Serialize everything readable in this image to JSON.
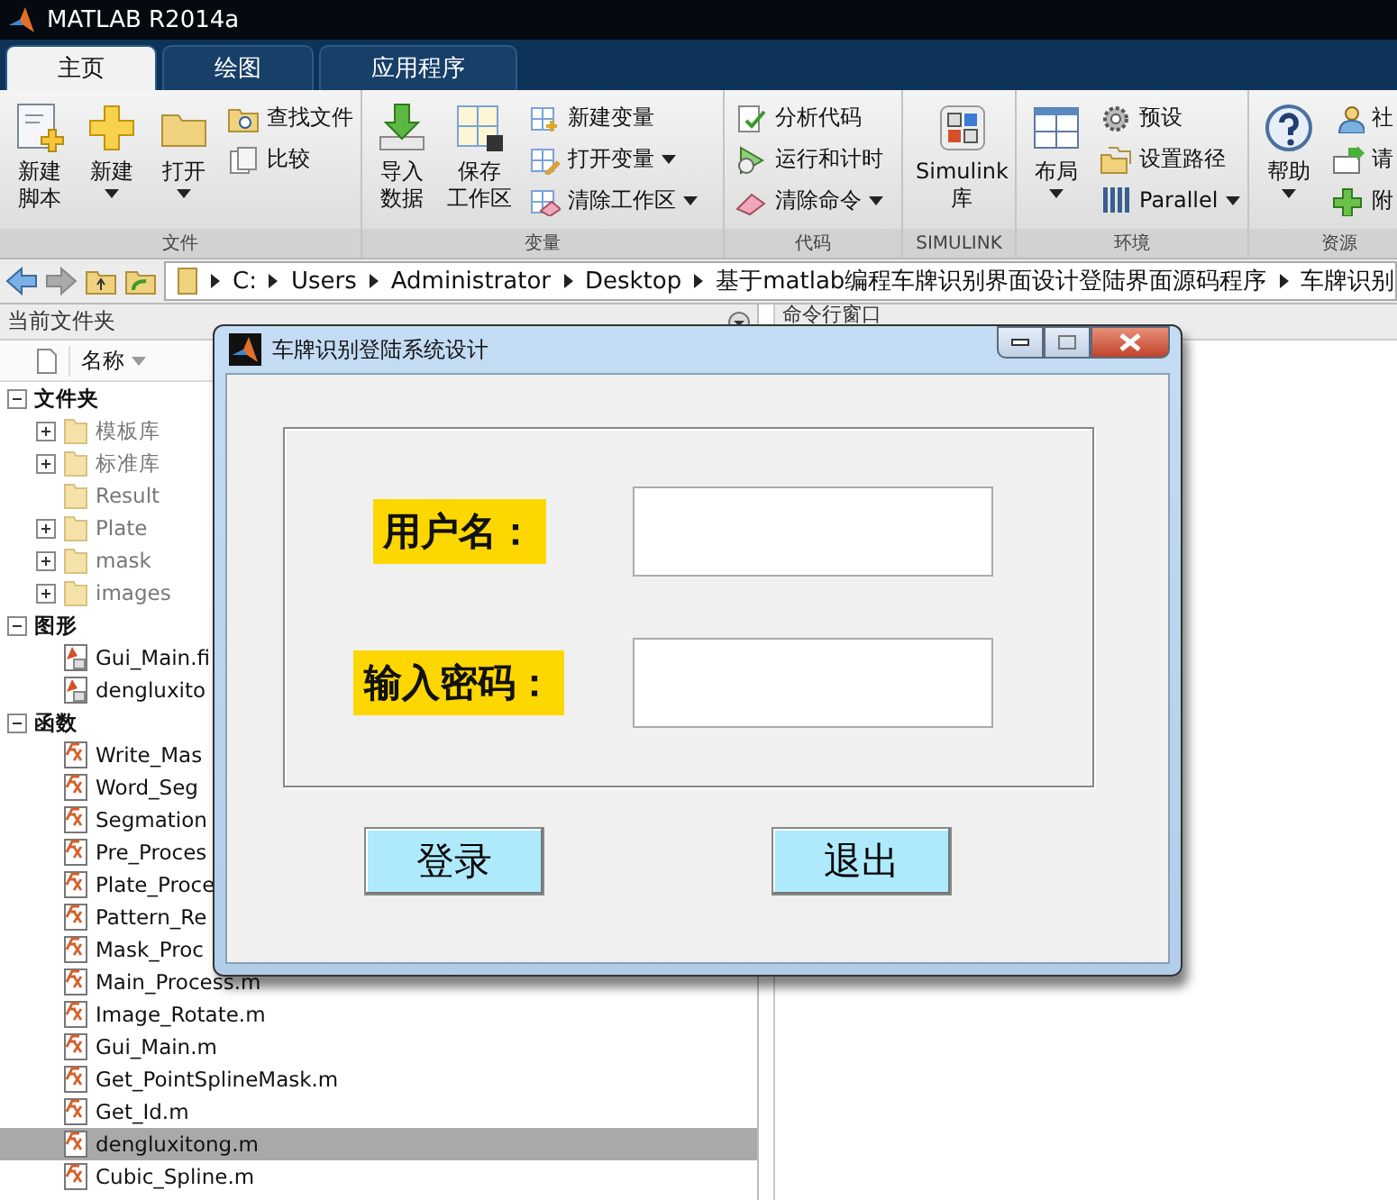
{
  "window": {
    "title": "MATLAB R2014a"
  },
  "tabs": [
    {
      "label": "主页",
      "selected": true
    },
    {
      "label": "绘图",
      "selected": false
    },
    {
      "label": "应用程序",
      "selected": false
    }
  ],
  "ribbon": {
    "groups": [
      {
        "label": "文件",
        "items": [
          {
            "kind": "large",
            "lines": [
              "新建",
              "脚本"
            ],
            "dropdown": false
          },
          {
            "kind": "large",
            "lines": [
              "新建"
            ],
            "dropdown": true
          },
          {
            "kind": "large",
            "lines": [
              "打开"
            ],
            "dropdown": true
          },
          {
            "kind": "stack",
            "items": [
              {
                "label": "查找文件",
                "dropdown": false
              },
              {
                "label": "比较",
                "dropdown": false
              }
            ]
          }
        ]
      },
      {
        "label": "变量",
        "items": [
          {
            "kind": "large",
            "lines": [
              "导入",
              "数据"
            ],
            "dropdown": false
          },
          {
            "kind": "large",
            "lines": [
              "保存",
              "工作区"
            ],
            "dropdown": false
          },
          {
            "kind": "stack",
            "items": [
              {
                "label": "新建变量",
                "dropdown": false
              },
              {
                "label": "打开变量",
                "dropdown": true
              },
              {
                "label": "清除工作区",
                "dropdown": true
              }
            ]
          }
        ]
      },
      {
        "label": "代码",
        "items": [
          {
            "kind": "stack",
            "items": [
              {
                "label": "分析代码",
                "dropdown": false
              },
              {
                "label": "运行和计时",
                "dropdown": false
              },
              {
                "label": "清除命令",
                "dropdown": true
              }
            ]
          }
        ]
      },
      {
        "label": "SIMULINK",
        "items": [
          {
            "kind": "large",
            "lines": [
              "Simulink",
              "库"
            ],
            "dropdown": false
          }
        ]
      },
      {
        "label": "环境",
        "items": [
          {
            "kind": "large",
            "lines": [
              "布局"
            ],
            "dropdown": true
          },
          {
            "kind": "stack",
            "items": [
              {
                "label": "预设",
                "dropdown": false
              },
              {
                "label": "设置路径",
                "dropdown": false
              },
              {
                "label": "Parallel",
                "dropdown": true
              }
            ]
          }
        ]
      },
      {
        "label": "资源",
        "items": [
          {
            "kind": "large",
            "lines": [
              "帮助"
            ],
            "dropdown": true
          },
          {
            "kind": "stack",
            "items": [
              {
                "label": "社"
              },
              {
                "label": "请"
              },
              {
                "label": "附"
              }
            ]
          }
        ]
      }
    ]
  },
  "address_bar": {
    "path": [
      "C:",
      "Users",
      "Administrator",
      "Desktop",
      "基于matlab编程车牌识别界面设计登陆界面源码程序",
      "车牌识别"
    ]
  },
  "current_folder": {
    "title": "当前文件夹",
    "column": "名称",
    "tree": [
      {
        "kind": "section",
        "label": "文件夹",
        "expanded": true,
        "selected": false,
        "children": [
          {
            "kind": "folder",
            "label": "模板库",
            "expanded": false,
            "selected": false
          },
          {
            "kind": "folder",
            "label": "标准库",
            "expanded": false,
            "selected": false
          },
          {
            "kind": "folder",
            "label": "Result",
            "selected": false
          },
          {
            "kind": "folder",
            "label": "Plate",
            "expanded": false,
            "selected": false
          },
          {
            "kind": "folder",
            "label": "mask",
            "expanded": false,
            "selected": false
          },
          {
            "kind": "folder",
            "label": "images",
            "expanded": false,
            "selected": false
          }
        ]
      },
      {
        "kind": "section",
        "label": "图形",
        "expanded": true,
        "selected": false,
        "children": [
          {
            "kind": "figure",
            "label": "Gui_Main.fi",
            "selected": false
          },
          {
            "kind": "figure",
            "label": "dengluxito",
            "selected": false
          }
        ]
      },
      {
        "kind": "section",
        "label": "函数",
        "expanded": true,
        "selected": false,
        "children": [
          {
            "kind": "function",
            "label": "Write_Mas",
            "selected": false
          },
          {
            "kind": "function",
            "label": "Word_Seg",
            "selected": false
          },
          {
            "kind": "function",
            "label": "Segmation",
            "selected": false
          },
          {
            "kind": "function",
            "label": "Pre_Proces",
            "selected": false
          },
          {
            "kind": "function",
            "label": "Plate_Proce",
            "selected": false
          },
          {
            "kind": "function",
            "label": "Pattern_Re",
            "selected": false
          },
          {
            "kind": "function",
            "label": "Mask_Proc",
            "selected": false
          },
          {
            "kind": "function",
            "label": "Main_Process.m",
            "selected": false
          },
          {
            "kind": "function",
            "label": "Image_Rotate.m",
            "selected": false
          },
          {
            "kind": "function",
            "label": "Gui_Main.m",
            "selected": false
          },
          {
            "kind": "function",
            "label": "Get_PointSplineMask.m",
            "selected": false
          },
          {
            "kind": "function",
            "label": "Get_Id.m",
            "selected": false
          },
          {
            "kind": "function",
            "label": "dengluxitong.m",
            "selected": true
          },
          {
            "kind": "function",
            "label": "Cubic_Spline.m",
            "selected": false
          }
        ]
      }
    ]
  },
  "command_window": {
    "title": "命令行窗口"
  },
  "dialog": {
    "title": "车牌识别登陆系统设计",
    "fields": [
      {
        "label": "用户名："
      },
      {
        "label": "输入密码："
      }
    ],
    "buttons": [
      "登录",
      "退出"
    ]
  }
}
